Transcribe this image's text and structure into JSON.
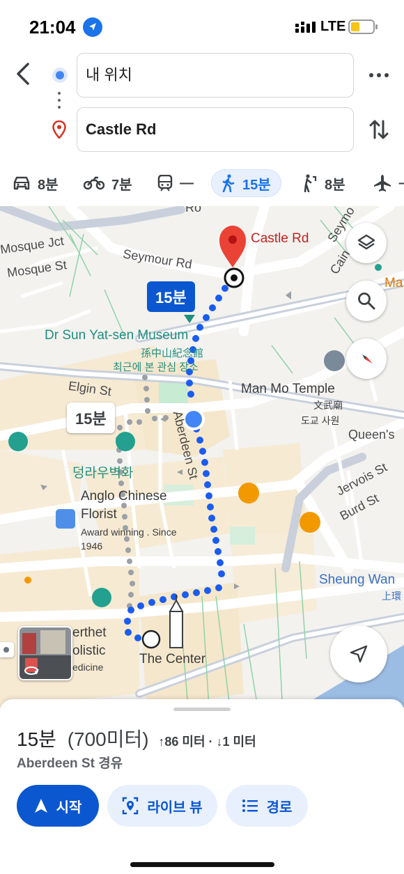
{
  "status": {
    "time": "21:04",
    "network": "LTE",
    "battery_level": 0.3
  },
  "search": {
    "origin": "내 위치",
    "destination": "Castle Rd",
    "back_icon": "chevron-left-icon",
    "more_icon": "more-horiz-icon",
    "swap_icon": "swap-vertical-icon"
  },
  "modes": [
    {
      "icon": "car-icon",
      "label": "8분"
    },
    {
      "icon": "motorcycle-icon",
      "label": "7분"
    },
    {
      "icon": "transit-icon",
      "label": "—"
    },
    {
      "icon": "walk-icon",
      "label": "15분",
      "active": true
    },
    {
      "icon": "rideshare-icon",
      "label": "8분"
    },
    {
      "icon": "flight-icon",
      "label": "–"
    }
  ],
  "map": {
    "streets": {
      "road_top": "Ro",
      "mosque_jct": "Mosque Jct",
      "mosque_st": "Mosque St",
      "seymour_rd": "Seymour Rd",
      "seymour_right": "Seymo",
      "caine": "Cain",
      "elgin_st": "Elgin St",
      "aberdeen_st": "Aberdeen St",
      "queens": "Queen's",
      "jervois_st": "Jervois St",
      "burd_st": "Burd St"
    },
    "places": {
      "castle_rd": "Castle Rd",
      "museum_en": "Dr Sun Yat-sen Museum",
      "museum_zh": "孫中山紀念館",
      "museum_ko": "최근에 본 관심 장소",
      "man_mo_en": "Man Mo Temple",
      "man_mo_zh": "文武廟",
      "man_mo_ko": "도교 사원",
      "duddell": "덩라우벽화",
      "anglo_1": "Anglo Chinese",
      "anglo_2": "Florist",
      "anglo_3": "Award winning . Since",
      "anglo_4": "1946",
      "sheung_wan": "Sheung Wan",
      "sheung_wan_zh": "上環",
      "the_center": "The Center",
      "herthet_1": "erthet",
      "herthet_2": "olistic",
      "herthet_3": "edicine",
      "ma_right": "Ma"
    },
    "route_badge": "15분",
    "alt_badge": "15분",
    "buttons": {
      "layers_icon": "layers-icon",
      "search_icon": "search-icon",
      "compass_icon": "compass-icon",
      "recenter_icon": "navigation-arrow-icon",
      "streetview_icon": "street-view-rotate-icon"
    }
  },
  "sheet": {
    "duration": "15분",
    "distance": "(700미터)",
    "elevation": "↑86 미터 · ↓1 미터",
    "via": "Aberdeen St 경유",
    "start_label": "시작",
    "live_label": "라이브 뷰",
    "route_label": "경로"
  }
}
